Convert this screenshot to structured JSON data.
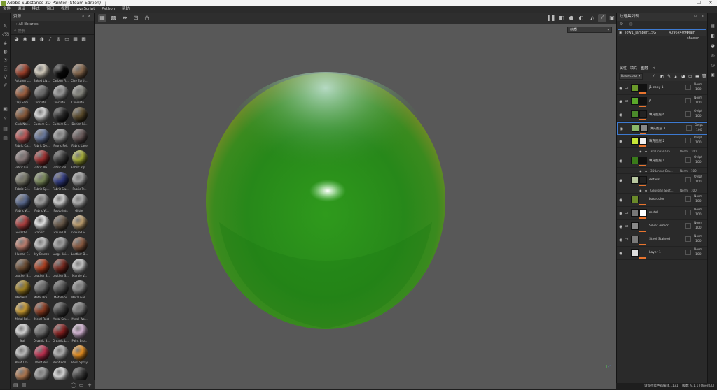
{
  "window": {
    "title": "Adobe Substance 3D Painter (Steam Edition) - j",
    "minimize": "—",
    "maximize": "☐",
    "close": "✕"
  },
  "menu": [
    "文件",
    "编辑",
    "模式",
    "窗口",
    "视图",
    "JavaScript",
    "Python",
    "帮助"
  ],
  "shelf": {
    "title": "资源",
    "library": "All libraries",
    "search_placeholder": "搜索",
    "items": [
      {
        "label": "Autumn L...",
        "color": "#a0402a"
      },
      {
        "label": "Baked Lig...",
        "color": "#d8d0c0"
      },
      {
        "label": "Carbon Fi...",
        "color": "#0a0a0a"
      },
      {
        "label": "Clay Earth...",
        "color": "#8a6a4e"
      },
      {
        "label": "Clay Sam...",
        "color": "#a06040"
      },
      {
        "label": "Concrete ...",
        "color": "#6a6a6a"
      },
      {
        "label": "Concrete ...",
        "color": "#9a9a9a"
      },
      {
        "label": "Concrete ...",
        "color": "#8a8a82"
      },
      {
        "label": "Cork Nat...",
        "color": "#8a5a3a"
      },
      {
        "label": "Custom S...",
        "color": "#d8d8d8"
      },
      {
        "label": "Custom S...",
        "color": "#2a2a2a"
      },
      {
        "label": "Denim Ri...",
        "color": "#5a4a2a"
      },
      {
        "label": "Fabric Ca...",
        "color": "#c05858"
      },
      {
        "label": "Fabric De...",
        "color": "#6a7aa0"
      },
      {
        "label": "Fabric Felt",
        "color": "#9a9a9a"
      },
      {
        "label": "Fabric Lace",
        "color": "#6a5a5a"
      },
      {
        "label": "Fabric Lin...",
        "color": "#8a7a7a"
      },
      {
        "label": "Fabric Ma...",
        "color": "#a03030"
      },
      {
        "label": "Fabric Rol...",
        "color": "#3a3a3a"
      },
      {
        "label": "Fabric Rip...",
        "color": "#a8b038"
      },
      {
        "label": "Fabric Sc...",
        "color": "#7a7a6a"
      },
      {
        "label": "Fabric Sp...",
        "color": "#7a8a5a"
      },
      {
        "label": "Fabric Sw...",
        "color": "#303a80"
      },
      {
        "label": "Fabric Tr...",
        "color": "#a0a0a0"
      },
      {
        "label": "Fabric W...",
        "color": "#5a6a90"
      },
      {
        "label": "Fabric W...",
        "color": "#a0a0a0"
      },
      {
        "label": "Footprints",
        "color": "#d0d0d0"
      },
      {
        "label": "Glitter",
        "color": "#b0b0b0"
      },
      {
        "label": "Gouache ...",
        "color": "#b04040"
      },
      {
        "label": "Graphic L...",
        "color": "#e8e8e8"
      },
      {
        "label": "Ground N...",
        "color": "#6a5a4a"
      },
      {
        "label": "Ground S...",
        "color": "#c0a070"
      },
      {
        "label": "Human F...",
        "color": "#c08070"
      },
      {
        "label": "Ivy Branch",
        "color": "#c0c0c0"
      },
      {
        "label": "Large Kni...",
        "color": "#a0a0a0"
      },
      {
        "label": "Leather D...",
        "color": "#8a5a40"
      },
      {
        "label": "Leather B...",
        "color": "#6a4a30"
      },
      {
        "label": "Leather S...",
        "color": "#b04020"
      },
      {
        "label": "Leather S...",
        "color": "#7a2a20"
      },
      {
        "label": "Marble V...",
        "color": "#c8c8c8"
      },
      {
        "label": "Medieva...",
        "color": "#a08020"
      },
      {
        "label": "Metal Bra...",
        "color": "#6a6a6a"
      },
      {
        "label": "Metal Foil",
        "color": "#505050"
      },
      {
        "label": "Metal Gal...",
        "color": "#8a8a8a"
      },
      {
        "label": "Metal Pol...",
        "color": "#c89a30"
      },
      {
        "label": "Metal Rust",
        "color": "#8a3a20"
      },
      {
        "label": "Metal Sm...",
        "color": "#404040"
      },
      {
        "label": "Metal Wo...",
        "color": "#7a7a7a"
      },
      {
        "label": "Nail",
        "color": "#d8d8d8"
      },
      {
        "label": "Organic B...",
        "color": "#707070"
      },
      {
        "label": "Organic L...",
        "color": "#8a2020"
      },
      {
        "label": "Paint Bru...",
        "color": "#d8b8d8"
      },
      {
        "label": "Paint Cra...",
        "color": "#c0c0c0"
      },
      {
        "label": "Paint Roll",
        "color": "#c03050"
      },
      {
        "label": "Paint Roll...",
        "color": "#b0b0b0"
      },
      {
        "label": "Paint Spray",
        "color": "#e89020"
      },
      {
        "label": "",
        "color": "#b07850"
      },
      {
        "label": "",
        "color": "#9a9a9a"
      },
      {
        "label": "",
        "color": "#d8d8d8"
      },
      {
        "label": "",
        "color": "#3a3a3a"
      }
    ]
  },
  "viewport": {
    "view_mode": "材质"
  },
  "texture_set": {
    "title": "纹理集列表",
    "name": "Jow1_lambert1SG",
    "resolution": "4096x4096",
    "shader": "Main shader"
  },
  "layers_panel": {
    "tabs": [
      "属性 - 填充",
      "图层"
    ],
    "blend_mode": "Base color",
    "layers": [
      {
        "name": "j1 copy 1",
        "blend": "Norm",
        "opacity": "100",
        "thumb": "#6a9a2a",
        "mask": "#111"
      },
      {
        "name": "j1",
        "blend": "Norm",
        "opacity": "100",
        "thumb": "#5aa82a",
        "mask": "#111"
      },
      {
        "name": "填充图层 6",
        "blend": "Ovlpt",
        "opacity": "100",
        "thumb": "#4a8a2a",
        "mask": "#222"
      },
      {
        "name": "填充图层 3",
        "blend": "Ovlpt",
        "opacity": "100",
        "thumb": "#8ab86a",
        "mask": "#888"
      },
      {
        "name": "填充图层 2",
        "blend": "Ovlpt",
        "opacity": "100",
        "thumb": "#c8e838",
        "mask": "#eee"
      },
      {
        "name": "填充图层 1",
        "blend": "Ovlpt",
        "opacity": "100",
        "thumb": "#3a7a1a",
        "mask": "#111"
      },
      {
        "name": "details",
        "blend": "Ovlpt",
        "opacity": "100",
        "thumb": "#b8c8a0",
        "mask": "#222"
      },
      {
        "name": "basecolor",
        "blend": "Norm",
        "opacity": "100",
        "thumb": "#6a8a2a",
        "mask": ""
      },
      {
        "name": "metal",
        "blend": "Norm",
        "opacity": "100",
        "thumb": "#777",
        "mask": "#fff"
      },
      {
        "name": "Silver Armor",
        "blend": "Norm",
        "opacity": "100",
        "thumb": "#888",
        "mask": ""
      },
      {
        "name": "Steel Stained",
        "blend": "Norm",
        "opacity": "100",
        "thumb": "#7a7a7a",
        "mask": ""
      },
      {
        "name": "Layer 1",
        "blend": "Norm",
        "opacity": "100",
        "thumb": "#ddd",
        "mask": ""
      }
    ],
    "effects": [
      {
        "name": "3D Linear Gra...",
        "blend": "Norm",
        "opacity": "100"
      },
      {
        "name": "3D Linear Gra...",
        "blend": "Norm",
        "opacity": "100"
      },
      {
        "name": "Gaussian Spot...",
        "blend": "Norm",
        "opacity": "100"
      }
    ]
  },
  "status": {
    "message": "请等待着色器编译...",
    "zoom": "131",
    "version": "版本: 9.1.1 (OpenGL)"
  }
}
